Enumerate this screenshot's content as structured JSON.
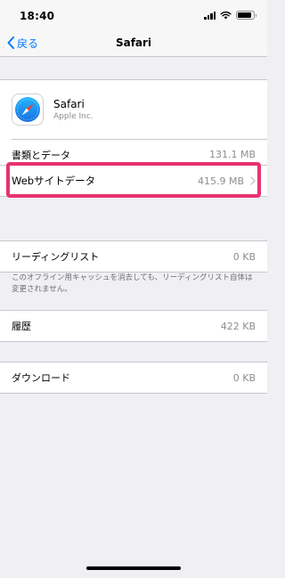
{
  "status": {
    "time": "18:40"
  },
  "nav": {
    "back_label": "戻る",
    "title": "Safari"
  },
  "app": {
    "name": "Safari",
    "vendor": "Apple Inc."
  },
  "rows": {
    "docs_and_data": {
      "label": "書類とデータ",
      "value": "131.1 MB"
    },
    "website_data": {
      "label": "Webサイトデータ",
      "value": "415.9 MB"
    },
    "reading_list": {
      "label": "リーディングリスト",
      "value": "0 KB"
    },
    "history": {
      "label": "履歴",
      "value": "422 KB"
    },
    "downloads": {
      "label": "ダウンロード",
      "value": "0 KB"
    }
  },
  "reading_list_note": "このオフライン用キャッシュを消去しても、リーディングリスト自体は変更されません。",
  "colors": {
    "accent": "#007aff",
    "highlight": "#e8336f",
    "background": "#efeff4"
  },
  "icons": [
    "signal-icon",
    "wifi-icon",
    "battery-icon",
    "back-chevron-icon",
    "safari-compass-icon",
    "chevron-right-icon"
  ]
}
